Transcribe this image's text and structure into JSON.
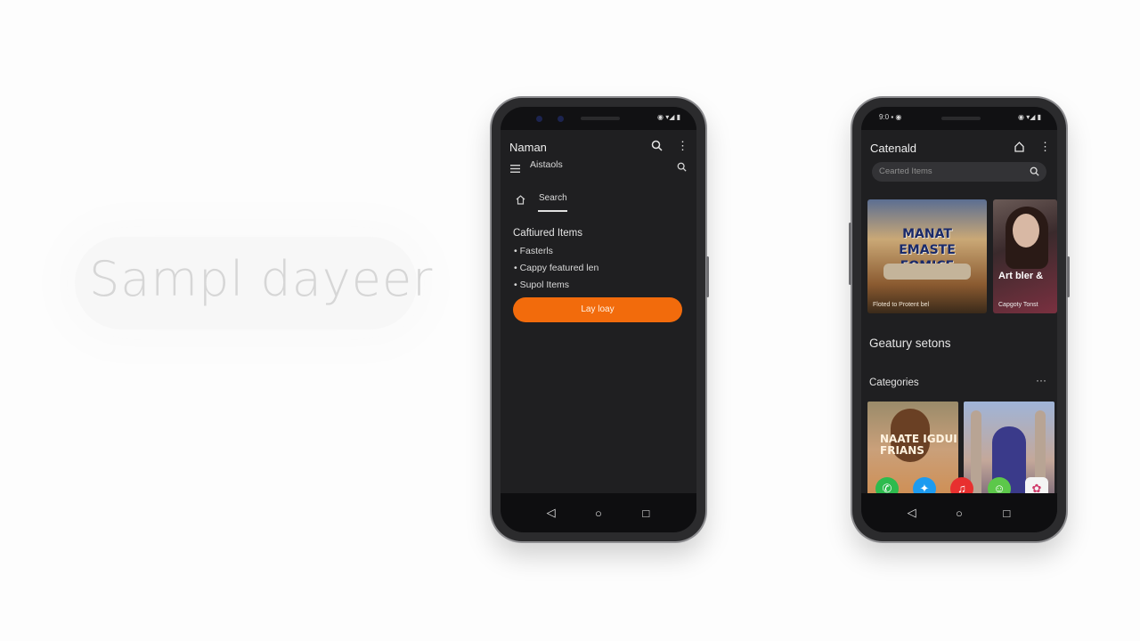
{
  "hero": {
    "text": "Sampl dayeer"
  },
  "left_phone": {
    "app_title": "Naman",
    "menu_label": "Aistaols",
    "tab_search": "Search",
    "section_title": "Caftiured Items",
    "list_items": [
      "Fasterls",
      "Cappy featured len",
      "Supol Items"
    ],
    "cta_label": "Lay loay",
    "status_icons": "◉ ▾◢ ▮",
    "icons": [
      "search-icon",
      "more-vert-icon",
      "hamburger-icon",
      "home-icon",
      "back-icon",
      "home-circle-icon",
      "recents-icon"
    ]
  },
  "right_phone": {
    "app_title": "Catenald",
    "status_time": "9:0 ▪ ◉",
    "status_icons": "◉ ▾◢ ▮",
    "search_placeholder": "Cearted Items",
    "poster": {
      "title": "MANAT EMASTE FOMICE",
      "caption": "Floted to Protent bel"
    },
    "portrait": {
      "title": "Art bler &",
      "caption": "Capgoty Tonst"
    },
    "section_heading": "Geatury setons",
    "categories_label": "Categories",
    "more_label": "···",
    "tile_a_text": "NAATE IGDUI FRIANS",
    "app_icons": [
      "phone-icon",
      "twitter-icon",
      "music-icon",
      "chat-icon",
      "photos-icon"
    ],
    "colors": {
      "phone": "#2dbb4e",
      "twitter": "#1d9bf0",
      "music": "#e8302f",
      "chat": "#5cc84a"
    }
  }
}
